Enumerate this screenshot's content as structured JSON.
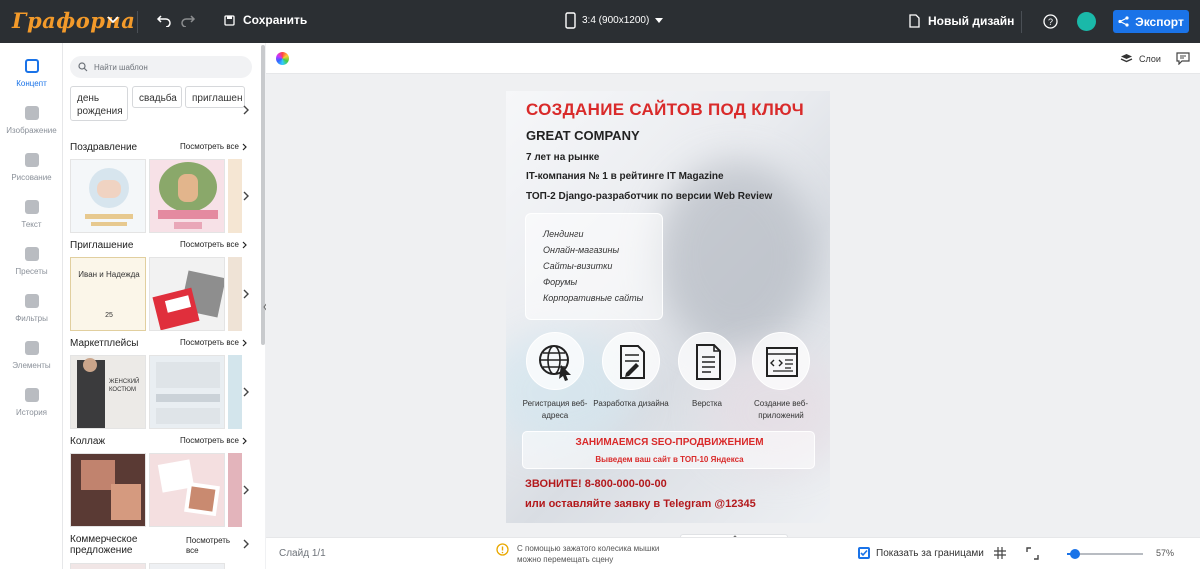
{
  "app": {
    "logo": "Графорна",
    "save_label": "Сохранить",
    "format_label": "3:4 (900x1200)",
    "new_design_label": "Новый дизайн",
    "export_label": "Экспорт"
  },
  "colors": {
    "accent": "#1a73e8",
    "topbar": "#2b2f33",
    "brand": "#f39a2a",
    "poster_red": "#d92a2a"
  },
  "nav": [
    {
      "label": "Концепт",
      "icon": "concept-icon",
      "active": true
    },
    {
      "label": "Изображение",
      "icon": "image-icon"
    },
    {
      "label": "Рисование",
      "icon": "draw-icon"
    },
    {
      "label": "Текст",
      "icon": "text-icon"
    },
    {
      "label": "Пресеты",
      "icon": "presets-icon"
    },
    {
      "label": "Фильтры",
      "icon": "filters-icon"
    },
    {
      "label": "Элементы",
      "icon": "elements-icon"
    },
    {
      "label": "История",
      "icon": "history-icon"
    }
  ],
  "panel": {
    "search_placeholder": "Найти шаблон",
    "chips": [
      "день рождения",
      "свадьба",
      "приглашен"
    ],
    "sections": [
      {
        "title": "Поздравление",
        "see_all": "Посмотреть все"
      },
      {
        "title": "Приглашение",
        "see_all": "Посмотреть все"
      },
      {
        "title": "Маркетплейсы",
        "see_all": "Посмотреть все"
      },
      {
        "title": "Коллаж",
        "see_all": "Посмотреть все"
      },
      {
        "title": "Коммерческое предложение",
        "see_all": "Посмотреть все"
      }
    ],
    "thumb_text": {
      "invite_names": "Иван и Надежда",
      "invite_day": "25",
      "market_title": "ЖЕНСКИЙ КОСТЮМ"
    }
  },
  "canvas": {
    "layers_label": "Слои"
  },
  "poster": {
    "title": "СОЗДАНИЕ САЙТОВ ПОД КЛЮЧ",
    "company": "GREAT COMPANY",
    "facts": [
      "7 лет на рынке",
      "IT-компания № 1 в рейтинге IT Magazine",
      "ТОП-2 Django-разработчик по версии Web Review"
    ],
    "services": [
      "Лендинги",
      "Онлайн-магазины",
      "Сайты-визитки",
      "Форумы",
      "Корпоративные сайты"
    ],
    "icons": [
      {
        "icon": "globe-cursor-icon",
        "caption": "Регистрация веб-адреса"
      },
      {
        "icon": "document-pen-icon",
        "caption": "Разработка дизайна"
      },
      {
        "icon": "document-lines-icon",
        "caption": "Верстка"
      },
      {
        "icon": "code-window-icon",
        "caption": "Создание веб-приложений"
      }
    ],
    "seo_title": "ЗАНИМАЕМСЯ SEO-ПРОДВИЖЕНИЕМ",
    "seo_sub": "Выведем ваш сайт в ТОП-10 Яндекса",
    "call1": "ЗВОНИТЕ! 8-800-000-00-00",
    "call2": "или оставляйте заявку в Telegram @12345"
  },
  "bottom": {
    "slide_label": "Слайд 1/1",
    "hint_line1": "С помощью зажатого колесика мышки",
    "hint_line2": "можно перемещать сцену",
    "show_bounds_label": "Показать за границами",
    "show_bounds_checked": true,
    "zoom_label": "57%",
    "zoom_level": 0.11
  }
}
